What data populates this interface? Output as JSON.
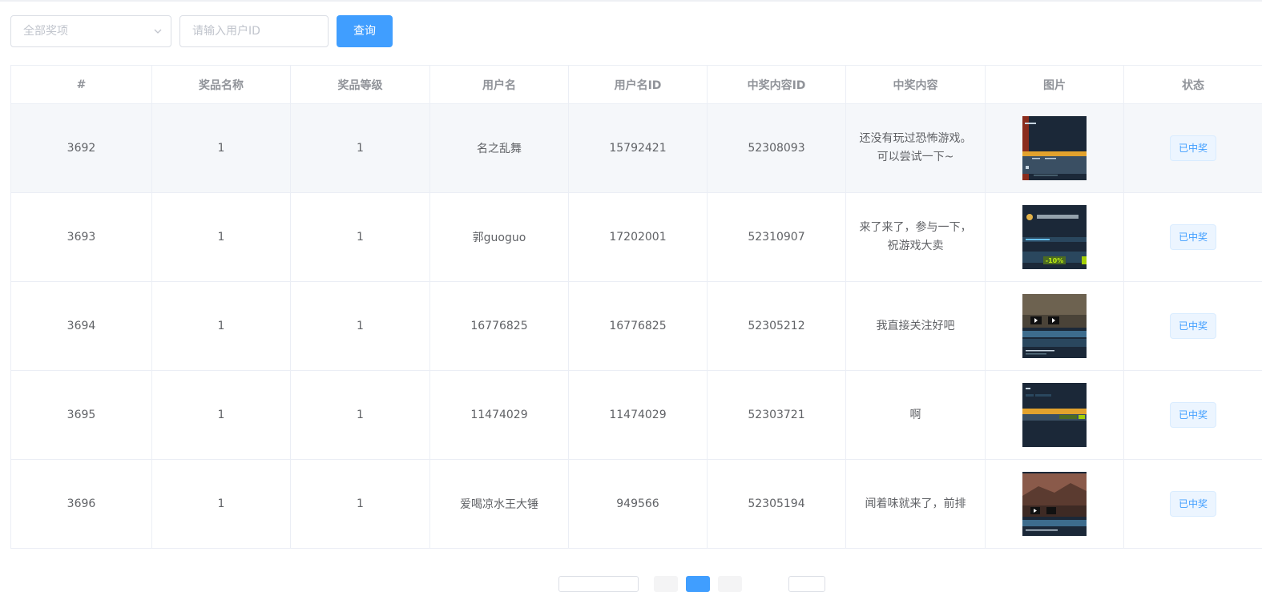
{
  "filters": {
    "prize_select": {
      "placeholder": "全部奖项"
    },
    "user_id_input": {
      "placeholder": "请输入用户ID",
      "value": ""
    },
    "query_button": {
      "label": "查询"
    }
  },
  "table": {
    "columns": [
      "#",
      "奖品名称",
      "奖品等级",
      "用户名",
      "用户名ID",
      "中奖内容ID",
      "中奖内容",
      "图片",
      "状态"
    ],
    "rows": [
      {
        "id": "3692",
        "prize_name": "1",
        "prize_level": "1",
        "username": "名之乱舞",
        "user_id": "15792421",
        "content_id": "52308093",
        "content": "还没有玩过恐怖游戏。可以尝试一下~",
        "status": "已中奖"
      },
      {
        "id": "3693",
        "prize_name": "1",
        "prize_level": "1",
        "username": "郭guoguo",
        "user_id": "17202001",
        "content_id": "52310907",
        "content": "来了来了，参与一下，祝游戏大卖",
        "status": "已中奖"
      },
      {
        "id": "3694",
        "prize_name": "1",
        "prize_level": "1",
        "username": "16776825",
        "user_id": "16776825",
        "content_id": "52305212",
        "content": "我直接关注好吧",
        "status": "已中奖"
      },
      {
        "id": "3695",
        "prize_name": "1",
        "prize_level": "1",
        "username": "11474029",
        "user_id": "11474029",
        "content_id": "52303721",
        "content": "啊",
        "status": "已中奖"
      },
      {
        "id": "3696",
        "prize_name": "1",
        "prize_level": "1",
        "username": "爱喝凉水王大锤",
        "user_id": "949566",
        "content_id": "52305194",
        "content": "闻着味就来了，前排",
        "status": "已中奖"
      }
    ]
  },
  "thumb_labels": {
    "discount": "-10%"
  },
  "colors": {
    "primary": "#409eff",
    "border": "#ebeef5",
    "highlight_row": "#f5f7fa",
    "steam_dark": "#1b2838"
  }
}
